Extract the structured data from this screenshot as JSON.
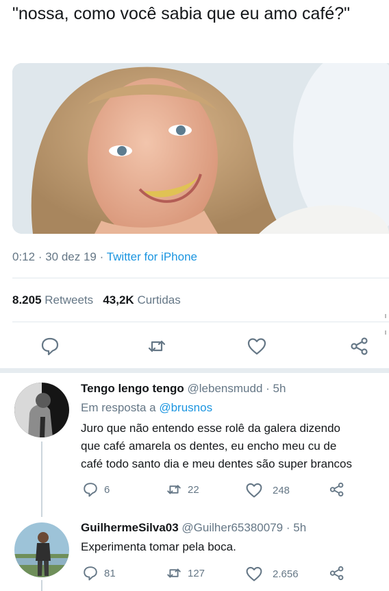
{
  "tweet": {
    "text": "\"nossa, como você sabia que eu amo café?\"",
    "time": "0:12",
    "date": "30 dez 19",
    "source": "Twitter for iPhone",
    "retweets_count": "8.205",
    "retweets_label": "Retweets",
    "likes_count": "43,2K",
    "likes_label": "Curtidas"
  },
  "replies": [
    {
      "name": "Tengo lengo tengo",
      "handle": "@lebensmudd",
      "age": "5h",
      "reply_to_prefix": "Em resposta a",
      "reply_to_handle": "@brusnos",
      "lines": [
        "Juro que não entendo esse rolê da galera dizendo",
        "que café amarela os dentes, eu encho meu cu de",
        "café todo santo dia e meu dentes são super brancos"
      ],
      "replies_count": "6",
      "retweets_count": "22",
      "likes_count": "248"
    },
    {
      "name": "GuilhermeSilva03",
      "handle": "@Guilher65380079",
      "age": "5h",
      "lines": [
        "Experimenta tomar pela boca."
      ],
      "replies_count": "81",
      "retweets_count": "127",
      "likes_count": "2.656"
    }
  ],
  "icons": {
    "reply": "speech-bubble",
    "retweet": "retweet-arrows",
    "like": "heart",
    "share": "share-nodes"
  },
  "colors": {
    "link": "#1b95e0",
    "secondary_text": "#657786",
    "divider": "#e1e8ed"
  }
}
